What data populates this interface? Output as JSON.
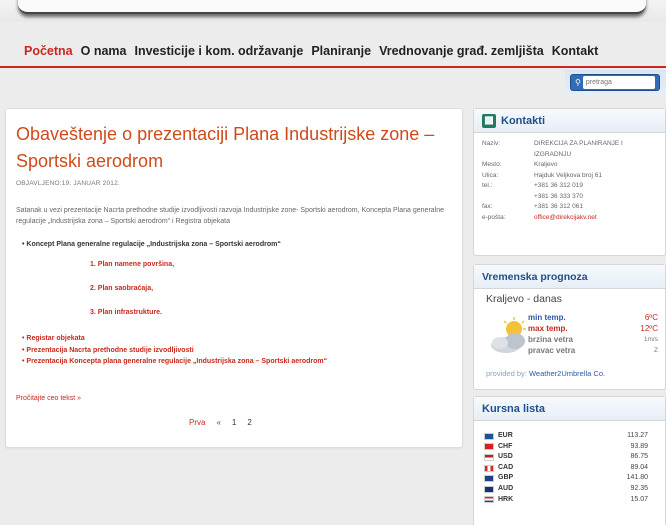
{
  "nav": {
    "items": [
      "Početna",
      "O nama",
      "Investicije i kom. održavanje",
      "Planiranje",
      "Vrednovanje građ. zemljišta",
      "Kontakt"
    ]
  },
  "search": {
    "placeholder": "pretraga"
  },
  "article": {
    "title": "Obaveštenje o prezentaciji Plana Industrijske zone – Sportski aerodrom",
    "published": "OBJAVLJENO:19. JANUAR 2012.",
    "intro": "Satanak u vezi prezentacije Nacrta prethodne studije izvodljivosti razvoja Industrijske zone- Sportski aerodrom, Koncepta Plana generalne regulacije „Industrijska zona – Sportski aerodrom“ i Registra objekata",
    "bullet_main": "Koncept Plana generalne regulacije „Industrijska zona – Sportski aerodrom“",
    "subitems": [
      "1. Plan namene površina,",
      "2. Plan saobraćaja,",
      "3. Plan infrastrukture."
    ],
    "links": [
      "Registar objekata",
      "Prezentacija Nacrta prethodne studije izvodljivosti",
      "Prezentacija Koncepta plana generalne regulacije „Industrijska zona – Sportski aerodrom“"
    ],
    "read_more": "Pročitajte ceo tekst »",
    "pager": {
      "first": "Prva",
      "prev": "«",
      "p1": "1",
      "p2": "2"
    }
  },
  "contacts": {
    "heading": "Kontakti",
    "rows": [
      {
        "k": "Naziv:",
        "v": "DIREKCIJA ZA PLANIRANJE I"
      },
      {
        "k": "",
        "v": "IZGRADNJU"
      },
      {
        "k": "Mesto:",
        "v": "Kraljevo"
      },
      {
        "k": "Ulica:",
        "v": "Hajduk Veljkova broj 61"
      },
      {
        "k": "tel.:",
        "v": "+381 36 312 019"
      },
      {
        "k": "",
        "v": "+381 36 333 370"
      },
      {
        "k": "fax:",
        "v": "+381 36 312 061"
      },
      {
        "k": "e-pošta:",
        "v": "office@direkcijakv.net"
      }
    ]
  },
  "weather": {
    "heading": "Vremenska prognoza",
    "location": "Kraljevo - danas",
    "min_label": "min temp.",
    "min_value": "6ºC",
    "max_label": "max temp.",
    "max_value": "12ºC",
    "speed_label": "brzina vetra",
    "speed_value": "1m/s",
    "dir_label": "pravac vetra",
    "dir_value": "Z",
    "provided_by": "provided by:",
    "provider": "Weather2Umbrella Co."
  },
  "currency": {
    "heading": "Kursna lista",
    "rows": [
      {
        "code": "EUR",
        "rate": "113.27"
      },
      {
        "code": "CHF",
        "rate": "93.89"
      },
      {
        "code": "USD",
        "rate": "86.75"
      },
      {
        "code": "CAD",
        "rate": "89.04"
      },
      {
        "code": "GBP",
        "rate": "141.80"
      },
      {
        "code": "AUD",
        "rate": "92.35"
      },
      {
        "code": "HRK",
        "rate": "15.07"
      }
    ]
  },
  "colors": {
    "accent": "#c8281e",
    "title": "#d04a1a",
    "heading_blue": "#1f4f8a"
  }
}
